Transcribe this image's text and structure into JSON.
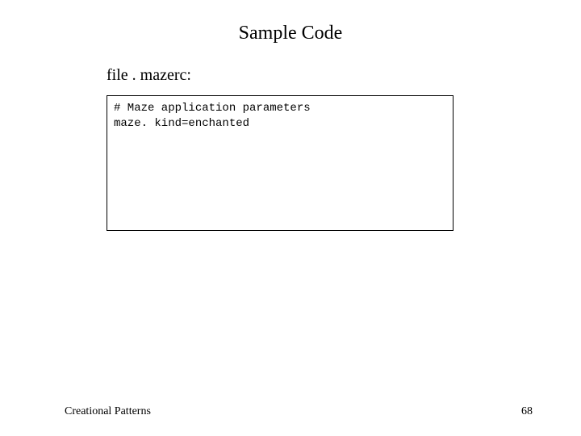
{
  "title": "Sample Code",
  "file_label": "file . mazerc:",
  "code": {
    "line1": "# Maze application parameters",
    "line2": "maze. kind=enchanted"
  },
  "footer": {
    "section": "Creational Patterns",
    "page": "68"
  }
}
